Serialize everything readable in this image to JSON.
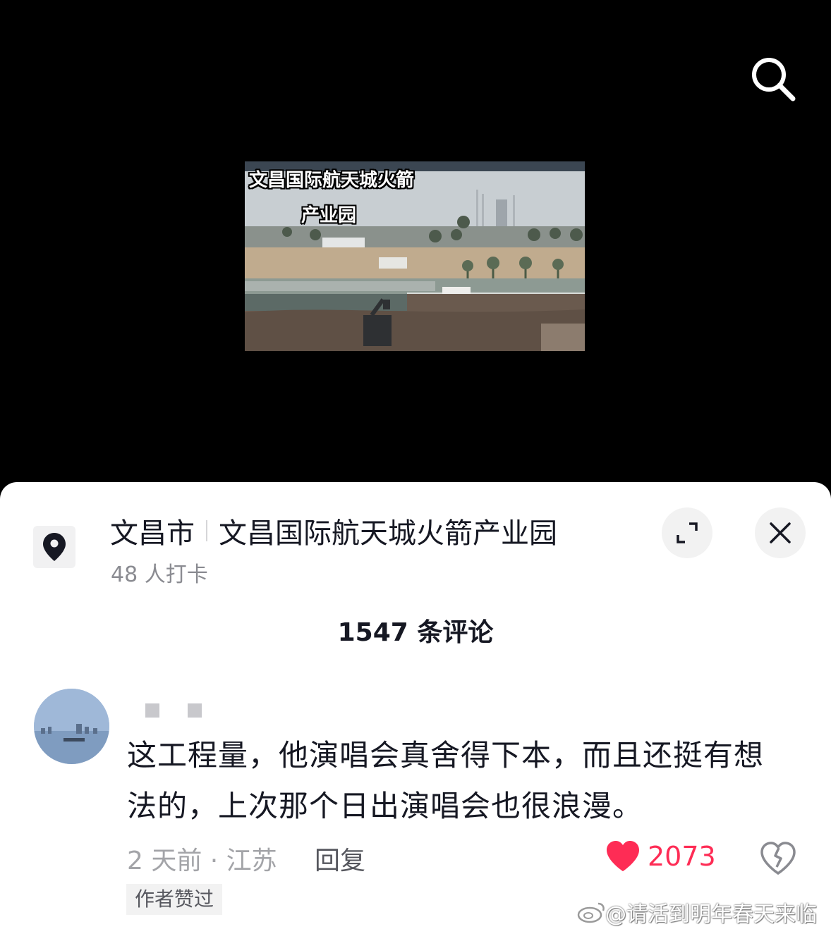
{
  "video": {
    "caption_line1": "文昌国际航天城火箭",
    "caption_line2": "产业园",
    "search_icon": "search-icon"
  },
  "location": {
    "city": "文昌市",
    "place": "文昌国际航天城火箭产业园",
    "checkins": "48 人打卡",
    "pin_icon": "location-pin-icon",
    "expand_icon": "expand-icon",
    "close_icon": "close-icon"
  },
  "comments": {
    "count_label": "1547 条评论",
    "items": [
      {
        "username": "■ ■",
        "text": "这工程量，他演唱会真舍得下本，而且还挺有想法的，上次那个日出演唱会也很浪漫。",
        "meta": "2 天前 · 江苏",
        "reply_label": "回复",
        "likes": "2073",
        "badge": "作者赞过"
      }
    ]
  },
  "watermark": "@请活到明年春天来临",
  "colors": {
    "like_red": "#fe2c55",
    "text_primary": "#161823",
    "text_secondary": "#8a8b91"
  }
}
